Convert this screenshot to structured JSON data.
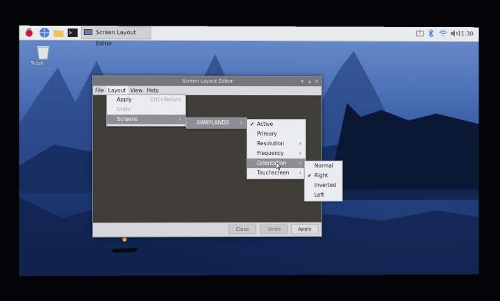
{
  "taskbar": {
    "app_label": "Screen Layout Editor",
    "clock": "11:30"
  },
  "desktop": {
    "trash_label": "Trash"
  },
  "window": {
    "title": "Screen Layout Editor",
    "menubar": [
      "File",
      "Layout",
      "View",
      "Help"
    ],
    "buttons": {
      "close": "Close",
      "undo": "Undo",
      "apply": "Apply"
    }
  },
  "layout_menu": {
    "apply": "Apply",
    "apply_shortcut": "Ctrl+Return",
    "undo": "Undo",
    "screens": "Screens"
  },
  "screens_menu": {
    "output": "XWAYLAND0"
  },
  "output_menu": {
    "active": "Active",
    "primary": "Primary",
    "resolution": "Resolution",
    "frequency": "Frequency",
    "orientation": "Orientation",
    "touchscreen": "Touchscreen"
  },
  "orientation_menu": {
    "normal": "Normal",
    "right": "Right",
    "inverted": "Inverted",
    "left": "Left"
  },
  "colors": {
    "highlight": "#8d8f95",
    "menu_bg": "#ebecef",
    "canvas": "#403e38"
  }
}
